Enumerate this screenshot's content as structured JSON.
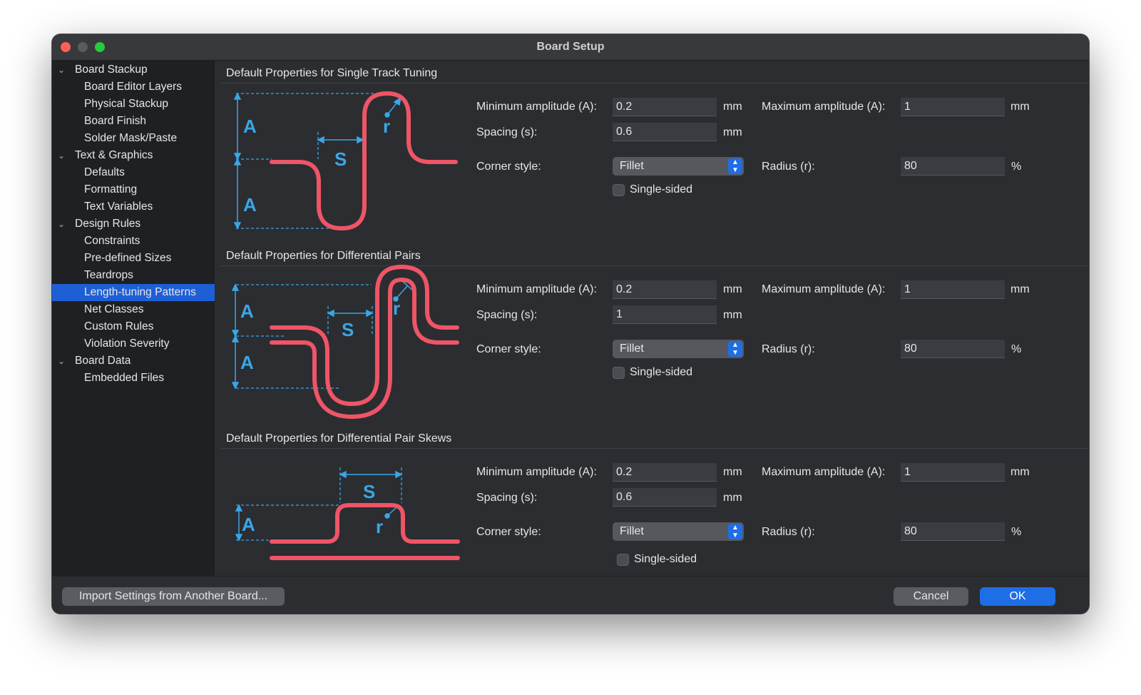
{
  "window": {
    "title": "Board Setup",
    "traffic_lights": {
      "close": "#fe5f57",
      "minimize": "#5a5b5f",
      "maximize": "#28c840"
    }
  },
  "sidebar": {
    "items": [
      {
        "label": "Board Stackup",
        "level": 0,
        "expanded": true
      },
      {
        "label": "Board Editor Layers",
        "level": 1
      },
      {
        "label": "Physical Stackup",
        "level": 1
      },
      {
        "label": "Board Finish",
        "level": 1
      },
      {
        "label": "Solder Mask/Paste",
        "level": 1
      },
      {
        "label": "Text & Graphics",
        "level": 0,
        "expanded": true
      },
      {
        "label": "Defaults",
        "level": 1
      },
      {
        "label": "Formatting",
        "level": 1
      },
      {
        "label": "Text Variables",
        "level": 1
      },
      {
        "label": "Design Rules",
        "level": 0,
        "expanded": true
      },
      {
        "label": "Constraints",
        "level": 1
      },
      {
        "label": "Pre-defined Sizes",
        "level": 1
      },
      {
        "label": "Teardrops",
        "level": 1
      },
      {
        "label": "Length-tuning Patterns",
        "level": 1,
        "selected": true
      },
      {
        "label": "Net Classes",
        "level": 1
      },
      {
        "label": "Custom Rules",
        "level": 1
      },
      {
        "label": "Violation Severity",
        "level": 1
      },
      {
        "label": "Board Data",
        "level": 0,
        "expanded": true
      },
      {
        "label": "Embedded Files",
        "level": 1
      }
    ]
  },
  "sections": [
    {
      "title": "Default Properties for Single Track Tuning",
      "min_amplitude": {
        "label": "Minimum amplitude (A):",
        "value": "0.2",
        "unit": "mm"
      },
      "max_amplitude": {
        "label": "Maximum amplitude (A):",
        "value": "1",
        "unit": "mm"
      },
      "spacing": {
        "label": "Spacing (s):",
        "value": "0.6",
        "unit": "mm"
      },
      "corner_style": {
        "label": "Corner style:",
        "value": "Fillet"
      },
      "radius": {
        "label": "Radius (r):",
        "value": "80",
        "unit": "%"
      },
      "single_sided": {
        "label": "Single-sided",
        "checked": false
      },
      "diagram_labels": {
        "a": "A",
        "s": "S",
        "r": "r"
      }
    },
    {
      "title": "Default Properties for Differential Pairs",
      "min_amplitude": {
        "label": "Minimum amplitude (A):",
        "value": "0.2",
        "unit": "mm"
      },
      "max_amplitude": {
        "label": "Maximum amplitude (A):",
        "value": "1",
        "unit": "mm"
      },
      "spacing": {
        "label": "Spacing (s):",
        "value": "1",
        "unit": "mm"
      },
      "corner_style": {
        "label": "Corner style:",
        "value": "Fillet"
      },
      "radius": {
        "label": "Radius (r):",
        "value": "80",
        "unit": "%"
      },
      "single_sided": {
        "label": "Single-sided",
        "checked": false
      },
      "diagram_labels": {
        "a": "A",
        "s": "S",
        "r": "r"
      }
    },
    {
      "title": "Default Properties for Differential Pair Skews",
      "min_amplitude": {
        "label": "Minimum amplitude (A):",
        "value": "0.2",
        "unit": "mm"
      },
      "max_amplitude": {
        "label": "Maximum amplitude (A):",
        "value": "1",
        "unit": "mm"
      },
      "spacing": {
        "label": "Spacing (s):",
        "value": "0.6",
        "unit": "mm"
      },
      "corner_style": {
        "label": "Corner style:",
        "value": "Fillet"
      },
      "radius": {
        "label": "Radius (r):",
        "value": "80",
        "unit": "%"
      },
      "single_sided": {
        "label": "Single-sided",
        "checked": false
      },
      "diagram_labels": {
        "a": "A",
        "s": "S",
        "r": "r"
      }
    }
  ],
  "colors": {
    "track": "#ee5566",
    "dimension": "#3aa6e6",
    "accent": "#1e6ee6"
  },
  "footer": {
    "import_label": "Import Settings from Another Board...",
    "cancel_label": "Cancel",
    "ok_label": "OK"
  }
}
